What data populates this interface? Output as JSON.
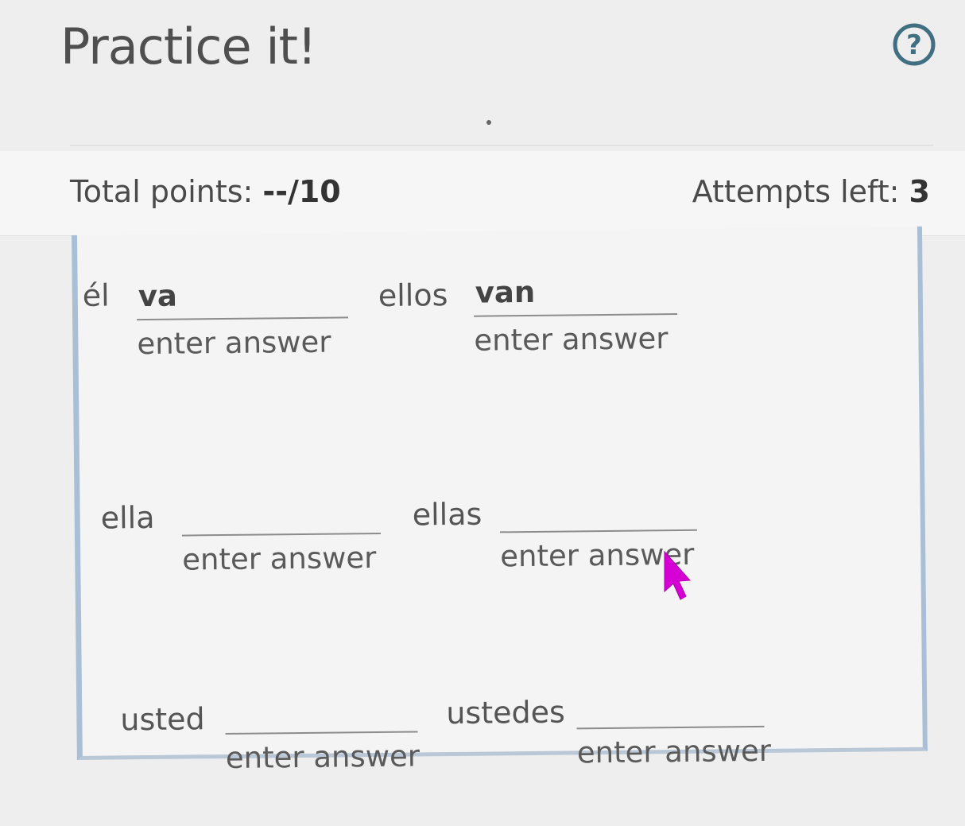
{
  "header": {
    "title": "Practice it!",
    "help_icon": "help-question-circle-icon"
  },
  "score": {
    "total_label": "Total points: ",
    "total_value": "--/10",
    "attempts_label": "Attempts left: ",
    "attempts_value": "3"
  },
  "rows": [
    {
      "left": {
        "subject": "él",
        "value": "va",
        "hint": "enter answer"
      },
      "right": {
        "subject": "ellos",
        "value": "van",
        "hint": "enter answer"
      }
    },
    {
      "left": {
        "subject": "ella",
        "value": "",
        "hint": "enter answer"
      },
      "right": {
        "subject": "ellas",
        "value": "",
        "hint": "enter answer"
      }
    },
    {
      "left": {
        "subject": "usted",
        "value": "",
        "hint": "enter answer"
      },
      "right": {
        "subject": "ustedes",
        "value": "",
        "hint": "enter answer"
      }
    }
  ],
  "colors": {
    "accent_border": "#a9bfd6",
    "help_icon": "#3f6f80",
    "cursor": "#d400d4"
  }
}
